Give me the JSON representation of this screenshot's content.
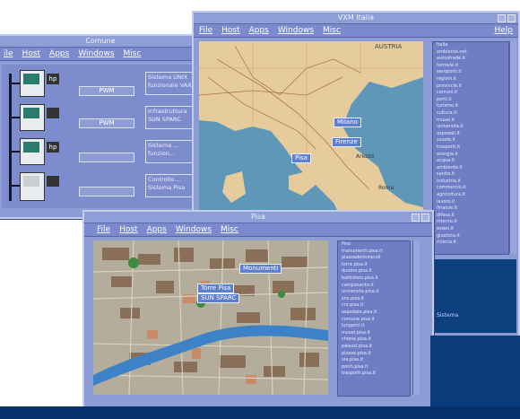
{
  "menu": {
    "file": "File",
    "host": "Host",
    "apps": "Apps",
    "windows": "Windows",
    "misc": "Misc",
    "help": "Help"
  },
  "win_left": {
    "title": "Comune",
    "menu_file": "ile",
    "rows": [
      {
        "label": "PWM",
        "text1": "Sistema UNIX",
        "text2": "funzionale VAX/"
      },
      {
        "label": "PWM",
        "text1": "Infrastruttura",
        "text2": "SUN SPARC"
      },
      {
        "label": "",
        "text1": "Sistema ...",
        "text2": "funzion..."
      },
      {
        "label": "",
        "text1": "Controllo ...",
        "text2": "Sistema Pisa"
      }
    ]
  },
  "win_italy": {
    "title": "VXM Italia",
    "place_labels": {
      "austria": "AUSTRIA",
      "milano": "Milano",
      "firenze": "Firenze",
      "pisa": "Pisa",
      "arezzo": "Arezzo",
      "roma": "Roma"
    },
    "sidebar_lines": [
      "Italia",
      "ambiente.net",
      "autostrade.it",
      "ferrovie.it",
      "aeroporti.it",
      "regioni.it",
      "provincie.it",
      "comuni.it",
      "porti.it",
      "turismo.it",
      "cultura.it",
      "musei.it",
      "universita.it",
      "ospedali.it",
      "scuole.it",
      "trasporti.it",
      "energia.it",
      "acqua.it",
      "ambiente.it",
      "sanita.it",
      "industria.it",
      "commercio.it",
      "agricoltura.it",
      "lavoro.it",
      "finanze.it",
      "difesa.it",
      "interno.it",
      "esteri.it",
      "giustizia.it",
      "ricerca.it"
    ],
    "footer_text": "Sistema"
  },
  "win_pisa": {
    "title": "Pisa",
    "place_labels": {
      "duomo": "Monumenti",
      "tower": "Torre Pisa",
      "sun": "SUN SPARC"
    },
    "sidebar_lines": [
      "Pisa",
      "monumenti.pisa.it",
      "piazzadeimiracoli",
      "torre.pisa.it",
      "duomo.pisa.it",
      "battistero.pisa.it",
      "camposanto.it",
      "universita.pisa.it",
      "sns.pisa.it",
      "cnr.pisa.it",
      "ospedale.pisa.it",
      "comune.pisa.it",
      "lungarni.it",
      "musei.pisa.it",
      "chiese.pisa.it",
      "palazzi.pisa.it",
      "piazze.pisa.it",
      "vie.pisa.it",
      "ponti.pisa.it",
      "trasporti.pisa.it"
    ]
  },
  "colors": {
    "window_bg": "#8c9cd4",
    "map_land": "#e8cfa0",
    "sea": "#5f97b8",
    "river": "#3d82c6",
    "desktop": "#08306a"
  }
}
